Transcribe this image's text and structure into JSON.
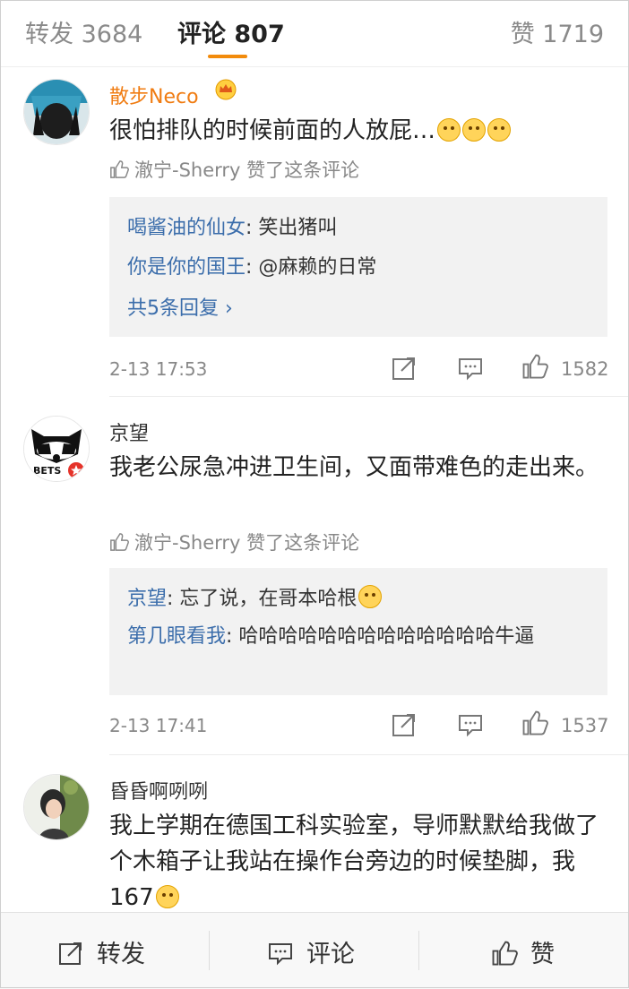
{
  "tabs": {
    "repost": "转发 3684",
    "comment": "评论 807",
    "like": "赞 1719"
  },
  "comments": [
    {
      "user": "散步Neco",
      "text": "很怕排队的时候前面的人放屁…",
      "liked_by": "澈宁-Sherry 赞了这条评论",
      "replies": [
        {
          "who": "喝酱油的仙女",
          "text": ": 笑出猪叫"
        },
        {
          "who": "你是你的国王",
          "text": ": @麻赖的日常"
        }
      ],
      "more_replies": "共5条回复 ›",
      "time": "2-13 17:53",
      "likes": "1582"
    },
    {
      "user": "京望",
      "text": "我老公尿急冲进卫生间，又面带难色的走出来。",
      "liked_by": "澈宁-Sherry 赞了这条评论",
      "replies": [
        {
          "who": "京望",
          "text": ": 忘了说，在哥本哈根"
        },
        {
          "who": "第几眼看我",
          "text": ": 哈哈哈哈哈哈哈哈哈哈哈哈哈牛逼"
        }
      ],
      "time": "2-13 17:41",
      "likes": "1537"
    },
    {
      "user": "昏昏啊咧咧",
      "text": "我上学期在德国工科实验室，导师默默给我做了个木箱子让我站在操作台旁边的时候垫脚，我167"
    }
  ],
  "bottom": {
    "repost": "转发",
    "comment": "评论",
    "like": "赞"
  },
  "colors": {
    "accent": "#f28b0c",
    "link": "#3b6dab",
    "vip_name": "#f07c12"
  }
}
